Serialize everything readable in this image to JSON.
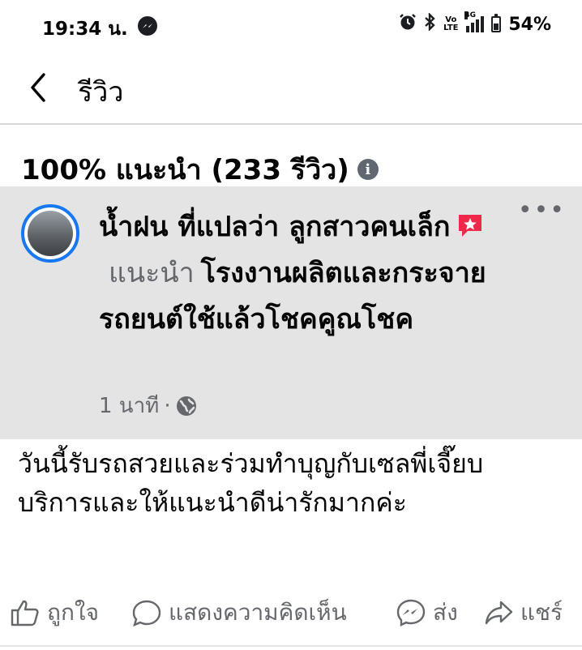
{
  "status_bar": {
    "time": "19:34 น.",
    "volte": "Vo LTE",
    "network": "4G",
    "battery": "54%",
    "battery_level": 0.54
  },
  "header": {
    "title": "รีวิว"
  },
  "summary": {
    "text": "100% แนะนำ (233 รีวิว)"
  },
  "review": {
    "reviewer": "น้ำฝน ที่แปลว่า ลูกสาวคนเล็ก",
    "verb": "แนะนำ",
    "page": "โรงงานผลิตและกระจายรถยนต์ใช้แล้วโชคคูณโชค",
    "time": "1 นาที",
    "separator": "·",
    "body_lines": [
      "วันนี้รับรถสวยและร่วมทำบุญกับเซลพี่เจี๊ยบ",
      "บริการและให้แนะนำดีน่ารักมากค่ะ"
    ]
  },
  "actions": {
    "like": "ถูกใจ",
    "comment": "แสดงความคิดเห็น",
    "send": "ส่ง",
    "share": "แชร์"
  },
  "colors": {
    "accent_blue": "#1877f2",
    "recommend_red": "#f02849",
    "secondary_text": "#65676b"
  },
  "icons": [
    "messenger-icon",
    "alarm-icon",
    "bluetooth-icon",
    "signal-icon",
    "battery-icon",
    "back-arrow-icon",
    "info-icon",
    "more-icon",
    "recommend-icon",
    "globe-icon",
    "like-icon",
    "comment-icon",
    "messenger-send-icon",
    "share-icon"
  ]
}
